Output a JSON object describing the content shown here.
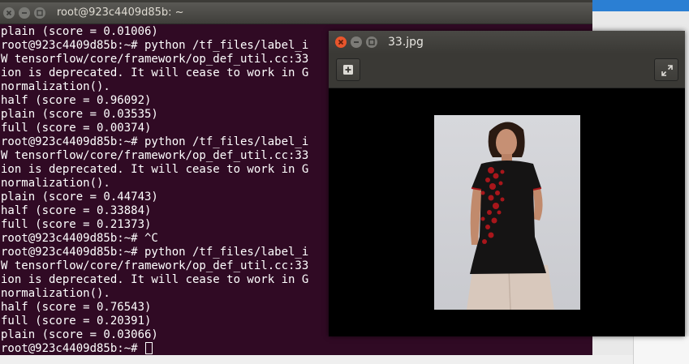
{
  "terminal": {
    "title": "root@923c4409d85b: ~",
    "lines": [
      "plain (score = 0.01006)",
      "root@923c4409d85b:~# python /tf_files/label_i",
      "W tensorflow/core/framework/op_def_util.cc:33",
      "ion is deprecated. It will cease to work in G",
      "normalization().",
      "half (score = 0.96092)",
      "plain (score = 0.03535)",
      "full (score = 0.00374)",
      "root@923c4409d85b:~# python /tf_files/label_i",
      "W tensorflow/core/framework/op_def_util.cc:33",
      "ion is deprecated. It will cease to work in G",
      "normalization().",
      "plain (score = 0.44743)",
      "half (score = 0.33884)",
      "full (score = 0.21373)",
      "root@923c4409d85b:~# ^C",
      "root@923c4409d85b:~# python /tf_files/label_i",
      "W tensorflow/core/framework/op_def_util.cc:33",
      "ion is deprecated. It will cease to work in G",
      "normalization().",
      "half (score = 0.76543)",
      "full (score = 0.20391)",
      "plain (score = 0.03066)"
    ],
    "prompt": "root@923c4409d85b:~# ",
    "background": "#300a24",
    "text_color": "#ffffff"
  },
  "viewer": {
    "title": "33.jpg",
    "toolbar": {
      "add_icon": "plus-icon",
      "expand_icon": "fullscreen-icon"
    }
  }
}
